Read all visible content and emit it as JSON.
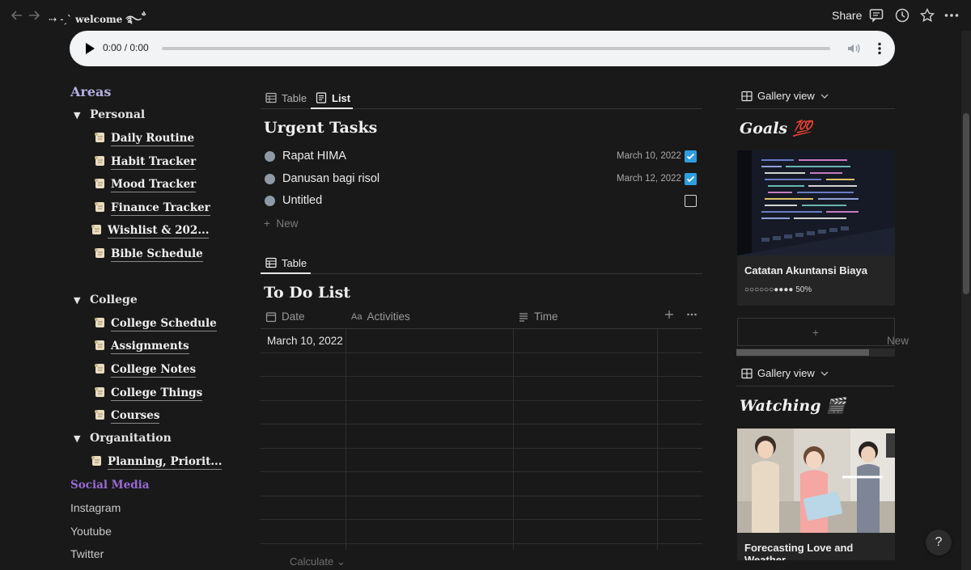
{
  "topbar": {
    "title": "⇢ ˗ˏˋ welcome ࿐ྂ",
    "share_label": "Share",
    "icons": [
      "back-arrow-icon",
      "forward-arrow-icon",
      "comment-icon",
      "history-icon",
      "star-icon",
      "more-icon"
    ]
  },
  "audio": {
    "time": "0:00 / 0:00"
  },
  "areas": {
    "title": "Areas",
    "groups": [
      {
        "label": "Personal",
        "items": [
          "Daily Routine",
          "Habit Tracker",
          "Mood Tracker",
          "Finance Tracker",
          "Wishlist & 202...",
          "Bible Schedule"
        ]
      },
      {
        "label": "College",
        "items": [
          "College Schedule",
          "Assignments",
          "College Notes",
          "College Things",
          "Courses"
        ]
      },
      {
        "label": "Organitation",
        "items": [
          "Planning, Priorit..."
        ]
      }
    ]
  },
  "social": {
    "title": "Social Media",
    "links": [
      "Instagram",
      "Youtube",
      "Twitter"
    ]
  },
  "urgent": {
    "tabs": [
      "Table",
      "List"
    ],
    "title": "Urgent Tasks",
    "tasks": [
      {
        "name": "Rapat HIMA",
        "date": "March 10, 2022",
        "done": true
      },
      {
        "name": "Danusan bagi risol",
        "date": "March 12, 2022",
        "done": true
      },
      {
        "name": "Untitled",
        "date": "",
        "done": false
      }
    ],
    "new_label": "New"
  },
  "todo": {
    "tab": "Table",
    "title": "To Do List",
    "columns": [
      "Date",
      "Activities",
      "Time"
    ],
    "rows": [
      {
        "date": "March 10, 2022",
        "activities": "",
        "time": ""
      }
    ],
    "calculate_label": "Calculate"
  },
  "goals": {
    "view_label": "Gallery view",
    "title": "Goals 💯",
    "card": {
      "title": "Catatan Akuntansi Biaya",
      "progress_dots": "○○○○○○●●●●",
      "progress": "50%",
      "progress_value": 0.5
    },
    "new_label": "New"
  },
  "watching": {
    "view_label": "Gallery view",
    "title": "Watching 🎬",
    "card": {
      "title": "Forecasting Love and Weather"
    }
  },
  "help_label": "?",
  "colors": {
    "background": "#191919",
    "areas_title": "#b6b1e3",
    "social_title": "#9a6ad6",
    "checkbox": "#2f9ee0"
  }
}
